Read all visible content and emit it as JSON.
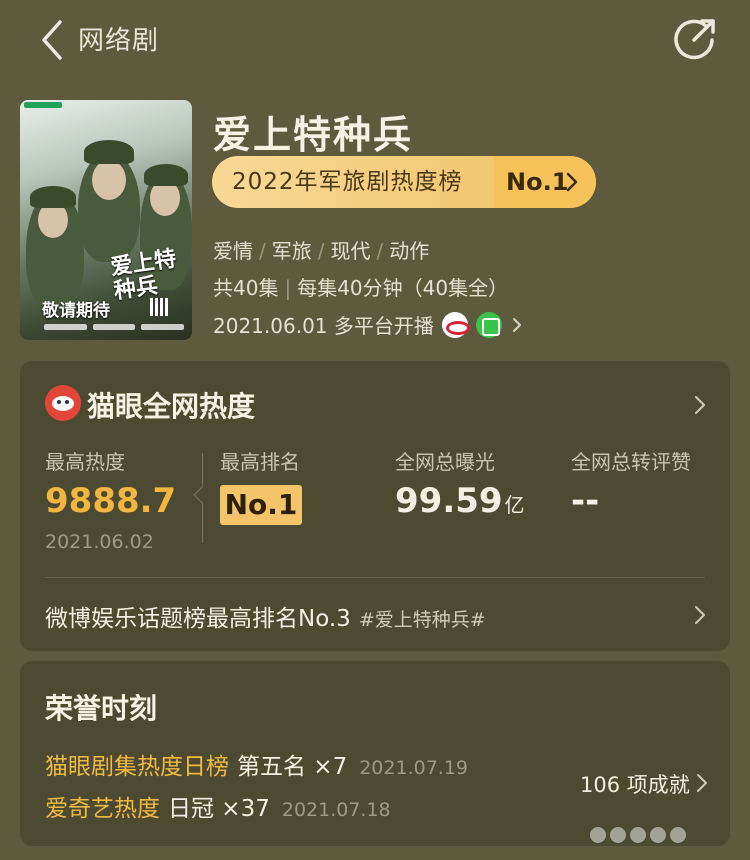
{
  "topbar": {
    "title": "网络剧"
  },
  "poster": {
    "calligraphy": "爱上特种兵",
    "band_text": "敬请期待"
  },
  "show": {
    "title": "爱上特种兵",
    "rank_label": "2022年军旅剧热度榜",
    "rank_badge": "No.1",
    "genres": [
      "爱情",
      "军旅",
      "现代",
      "动作"
    ],
    "episodes": "共40集",
    "duration": "每集40分钟（40集全）",
    "premiere": "2021.06.01 多平台开播"
  },
  "heat": {
    "title": "猫眼全网热度",
    "peak_heat_label": "最高热度",
    "peak_heat_value": "9888.7",
    "peak_heat_date": "2021.06.02",
    "peak_rank_label": "最高排名",
    "peak_rank_value": "No.1",
    "exposure_label": "全网总曝光",
    "exposure_value": "99.59",
    "exposure_unit": "亿",
    "engagement_label": "全网总转评赞",
    "engagement_value": "--",
    "weibo_text": "微博娱乐话题榜最高排名No.3",
    "weibo_tag": "#爱上特种兵#"
  },
  "honor": {
    "title": "荣誉时刻",
    "rows": [
      {
        "name": "猫眼剧集热度日榜",
        "rank": "第五名 ×7",
        "date": "2021.07.19"
      },
      {
        "name": "爱奇艺热度",
        "rank": "日冠 ×37",
        "date": "2021.07.18"
      }
    ],
    "count_label": "106 项成就"
  },
  "colors": {
    "background": "#5e5a3e",
    "card": "#4d4a32",
    "gold": "#f2b640",
    "pill": "#f5c35a"
  }
}
